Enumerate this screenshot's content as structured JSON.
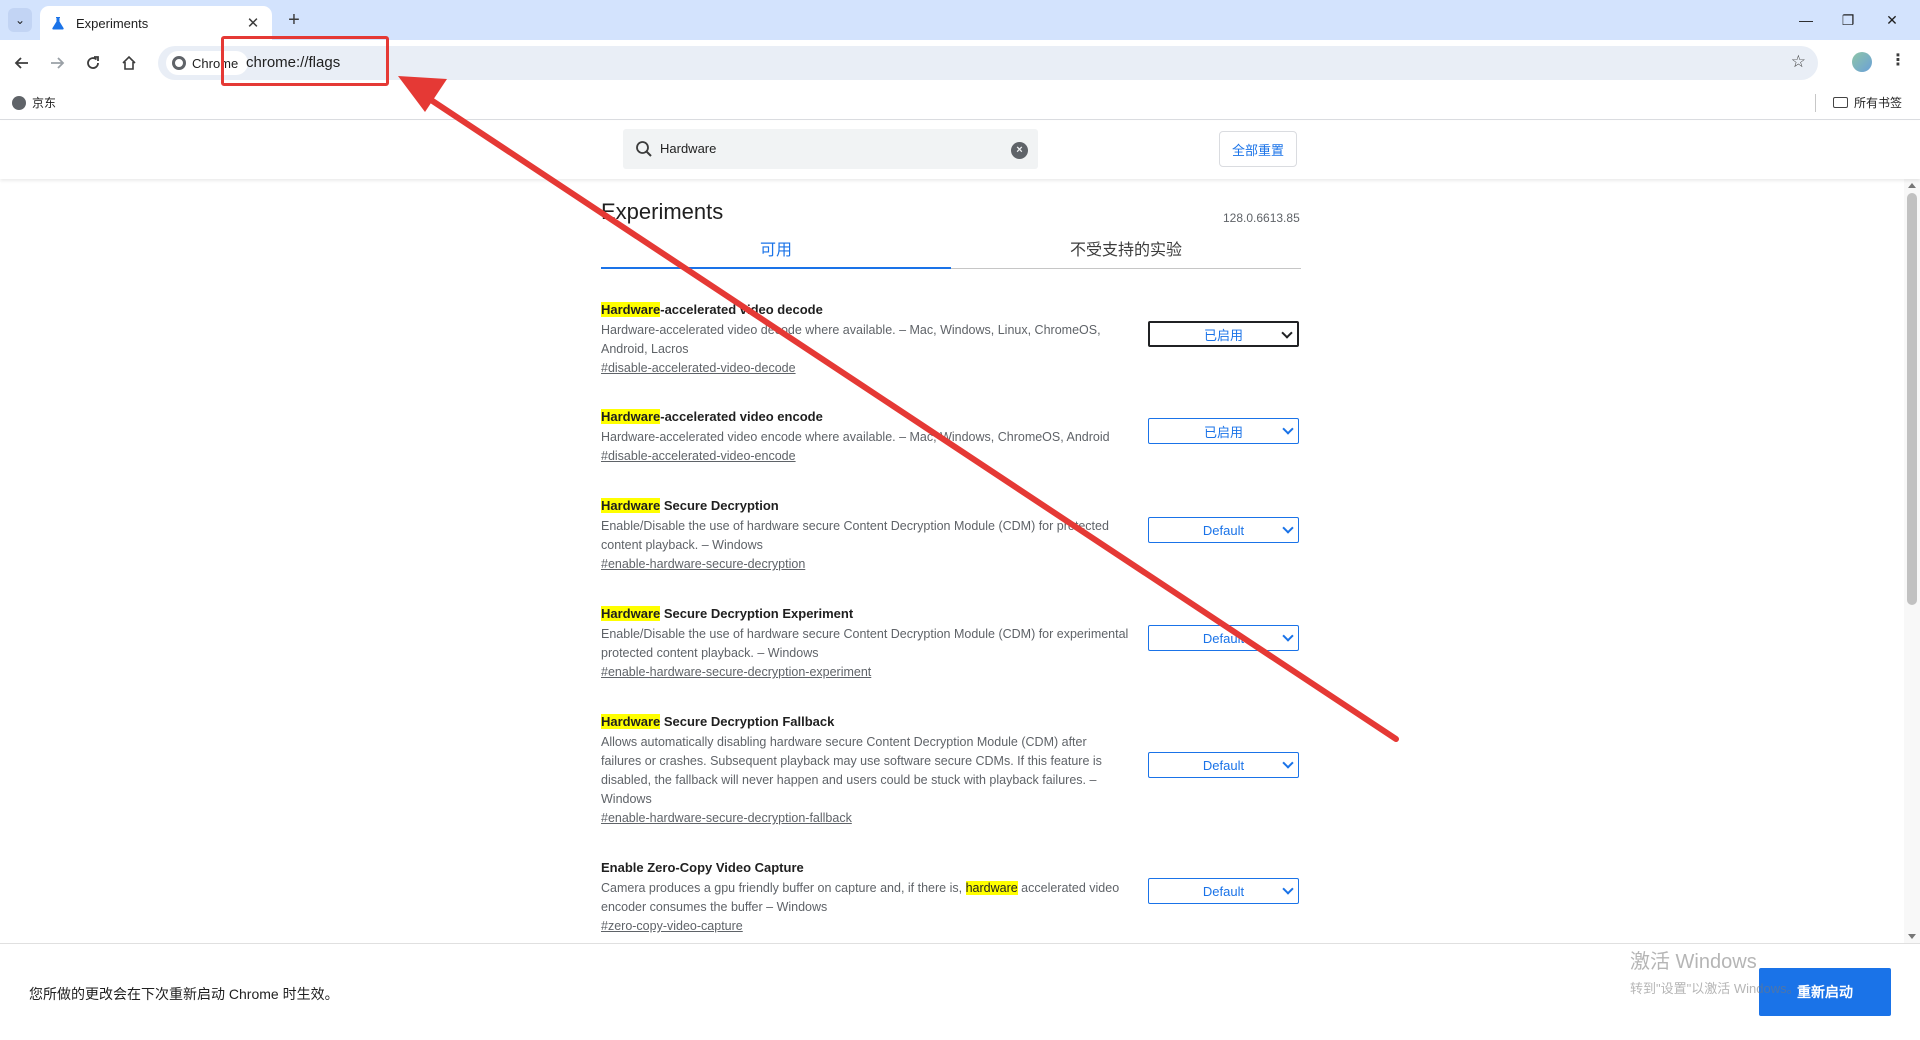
{
  "browser": {
    "tab_title": "Experiments",
    "tab_close": "✕",
    "new_tab": "+",
    "chip_label": "Chrome",
    "url": "chrome://flags",
    "bookmark_label": "京东",
    "all_bookmarks": "所有书签",
    "window_controls": {
      "minimize": "—",
      "restore": "❐",
      "close": "✕"
    }
  },
  "header": {
    "search_value": "Hardware",
    "reset_label": "全部重置"
  },
  "page": {
    "title": "Experiments",
    "version": "128.0.6613.85",
    "tabs": {
      "available": "可用",
      "unavailable": "不受支持的实验"
    }
  },
  "flags": [
    {
      "hl": "Hardware",
      "name_rest": "-accelerated video decode",
      "desc": "Hardware-accelerated video decode where available. – Mac, Windows, Linux, ChromeOS, Android, Lacros",
      "link": "#disable-accelerated-video-decode",
      "value": "已启用"
    },
    {
      "hl": "Hardware",
      "name_rest": "-accelerated video encode",
      "desc": "Hardware-accelerated video encode where available. – Mac, Windows, ChromeOS, Android",
      "link": "#disable-accelerated-video-encode",
      "value": "已启用"
    },
    {
      "hl": "Hardware",
      "name_rest": " Secure Decryption",
      "desc": "Enable/Disable the use of hardware secure Content Decryption Module (CDM) for protected content playback. – Windows",
      "link": "#enable-hardware-secure-decryption",
      "value": "Default"
    },
    {
      "hl": "Hardware",
      "name_rest": " Secure Decryption Experiment",
      "desc": "Enable/Disable the use of hardware secure Content Decryption Module (CDM) for experimental protected content playback. – Windows",
      "link": "#enable-hardware-secure-decryption-experiment",
      "value": "Default"
    },
    {
      "hl": "Hardware",
      "name_rest": " Secure Decryption Fallback",
      "desc": "Allows automatically disabling hardware secure Content Decryption Module (CDM) after failures or crashes. Subsequent playback may use software secure CDMs. If this feature is disabled, the fallback will never happen and users could be stuck with playback failures. – Windows",
      "link": "#enable-hardware-secure-decryption-fallback",
      "value": "Default"
    },
    {
      "name": "Enable Zero-Copy Video Capture",
      "desc_before": "Camera produces a gpu friendly buffer on capture and, if there is, ",
      "desc_hl": "hardware",
      "desc_after": " accelerated video encoder consumes the buffer – Windows",
      "link": "#zero-copy-video-capture",
      "value": "Default"
    }
  ],
  "bottom": {
    "message": "您所做的更改会在下次重新启动 Chrome 时生效。",
    "restart_label": "重新启动"
  },
  "watermark": {
    "line1": "激活 Windows",
    "line2": "转到\"设置\"以激活 Windows。"
  },
  "colors": {
    "accent": "#1a73e8",
    "highlight": "#ffff00",
    "annotation": "#e53935",
    "tabstrip": "#d3e3fd"
  }
}
